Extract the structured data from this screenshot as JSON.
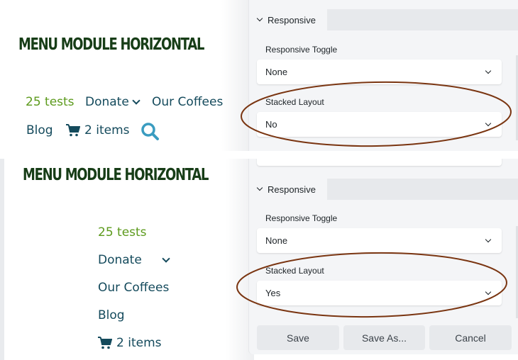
{
  "screens": {
    "top": {
      "site_title": "MENU MODULE HORIZONTAL",
      "menu": [
        {
          "label": "25 tests",
          "active": true
        },
        {
          "label": "Donate",
          "has_submenu": true
        },
        {
          "label": "Our Coffees"
        },
        {
          "label": "Blog"
        },
        {
          "label": "2 items",
          "icon": "cart-icon"
        },
        {
          "label": "",
          "icon": "search-icon"
        }
      ],
      "panel": {
        "section": "Responsive",
        "fields": [
          {
            "label": "Responsive Toggle",
            "value": "None"
          },
          {
            "label": "Stacked Layout",
            "value": "No"
          }
        ]
      }
    },
    "bottom": {
      "site_title": "MENU MODULE HORIZONTAL",
      "menu": [
        {
          "label": "25 tests",
          "active": true
        },
        {
          "label": "Donate",
          "has_submenu": true
        },
        {
          "label": "Our Coffees"
        },
        {
          "label": "Blog"
        },
        {
          "label": "2 items",
          "icon": "cart-icon"
        }
      ],
      "panel": {
        "section": "Responsive",
        "fields": [
          {
            "label": "Responsive Toggle",
            "value": "None"
          },
          {
            "label": "Stacked Layout",
            "value": "Yes"
          }
        ],
        "buttons": {
          "save": "Save",
          "save_as": "Save As...",
          "cancel": "Cancel"
        }
      }
    }
  },
  "colors": {
    "title": "#173d17",
    "menu_link": "#144a5c",
    "menu_active": "#5c9a1c",
    "search_icon": "#3a9cc0",
    "annotation": "#7a3511"
  }
}
